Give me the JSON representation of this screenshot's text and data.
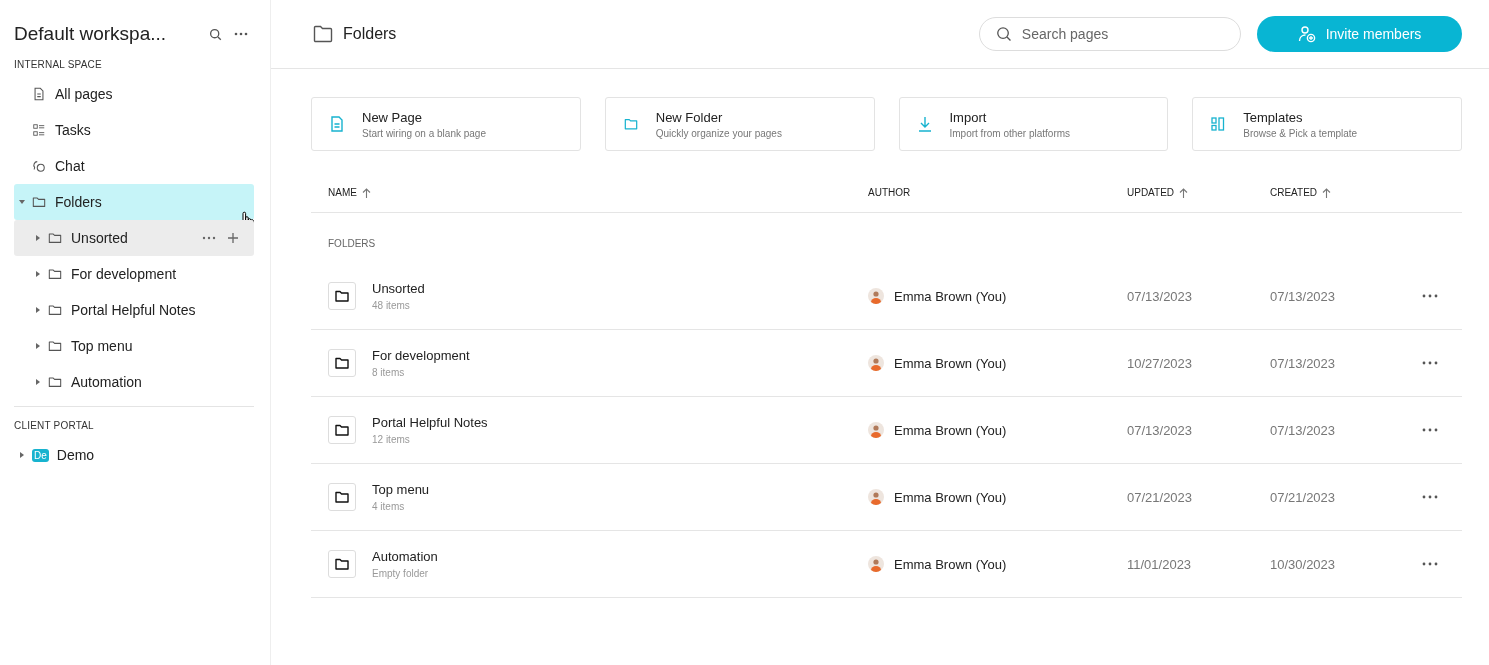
{
  "sidebar": {
    "workspace_title": "Default workspa...",
    "sections": [
      {
        "title": "INTERNAL SPACE",
        "items": [
          {
            "kind": "pages",
            "label": "All pages",
            "selected": false
          },
          {
            "kind": "tasks",
            "label": "Tasks",
            "selected": false
          },
          {
            "kind": "chat",
            "label": "Chat",
            "selected": false
          },
          {
            "kind": "folder",
            "label": "Folders",
            "selected": true,
            "expanded": true,
            "children": [
              {
                "kind": "folder",
                "label": "Unsorted",
                "selected": false,
                "expanded": false,
                "hovered": true
              },
              {
                "kind": "folder",
                "label": "For development",
                "selected": false,
                "expanded": false,
                "hovered": false
              },
              {
                "kind": "folder",
                "label": "Portal Helpful Notes",
                "selected": false,
                "expanded": false,
                "hovered": false
              },
              {
                "kind": "folder",
                "label": "Top menu",
                "selected": false,
                "expanded": false,
                "hovered": false
              },
              {
                "kind": "folder",
                "label": "Automation",
                "selected": false,
                "expanded": false,
                "hovered": false
              }
            ]
          }
        ]
      },
      {
        "title": "CLIENT PORTAL",
        "items": [
          {
            "kind": "portal",
            "badge": "De",
            "label": "Demo",
            "selected": false,
            "expanded": false
          }
        ]
      }
    ]
  },
  "header": {
    "title": "Folders",
    "search": {
      "placeholder": "Search pages"
    },
    "invite_button": "Invite members"
  },
  "actions": [
    {
      "kind": "page",
      "title": "New Page",
      "subtitle": "Start wiring on a blank page"
    },
    {
      "kind": "folder",
      "title": "New Folder",
      "subtitle": "Quickly organize your pages"
    },
    {
      "kind": "import",
      "title": "Import",
      "subtitle": "Import from other platforms"
    },
    {
      "kind": "templates",
      "title": "Templates",
      "subtitle": "Browse & Pick a template"
    }
  ],
  "table": {
    "columns": [
      {
        "label": "NAME",
        "sorted": true
      },
      {
        "label": "AUTHOR",
        "sorted": false
      },
      {
        "label": "UPDATED",
        "sorted": true
      },
      {
        "label": "CREATED",
        "sorted": true
      }
    ],
    "group_label": "FOLDERS",
    "rows": [
      {
        "name": "Unsorted",
        "count": "48 items",
        "author": "Emma Brown (You)",
        "updated": "07/13/2023",
        "created": "07/13/2023"
      },
      {
        "name": "For development",
        "count": "8 items",
        "author": "Emma Brown (You)",
        "updated": "10/27/2023",
        "created": "07/13/2023"
      },
      {
        "name": "Portal Helpful Notes",
        "count": "12 items",
        "author": "Emma Brown (You)",
        "updated": "07/13/2023",
        "created": "07/13/2023"
      },
      {
        "name": "Top menu",
        "count": "4 items",
        "author": "Emma Brown (You)",
        "updated": "07/21/2023",
        "created": "07/21/2023"
      },
      {
        "name": "Automation",
        "count": "Empty folder",
        "author": "Emma Brown (You)",
        "updated": "11/01/2023",
        "created": "10/30/2023"
      }
    ]
  }
}
